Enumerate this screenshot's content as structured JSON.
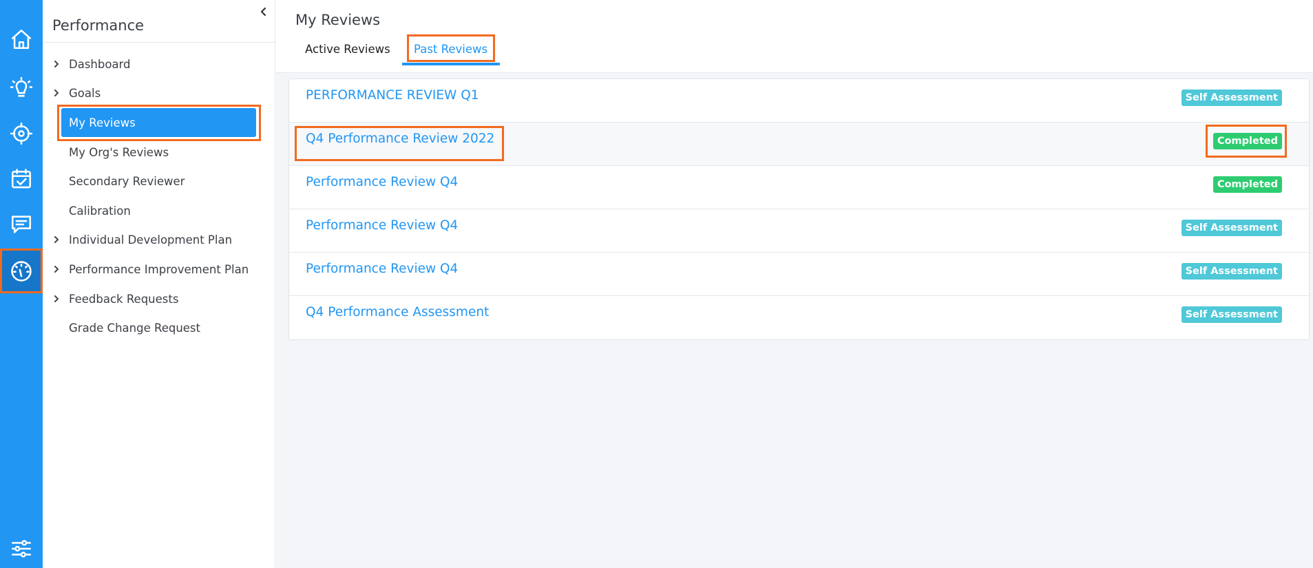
{
  "rail": {
    "items": [
      {
        "icon": "home-icon"
      },
      {
        "icon": "lightbulb-icon"
      },
      {
        "icon": "target-icon"
      },
      {
        "icon": "calendar-check-icon"
      },
      {
        "icon": "chat-icon"
      },
      {
        "icon": "speedometer-icon",
        "active": true
      },
      {
        "icon": "settings-sliders-icon"
      }
    ]
  },
  "sidebar": {
    "title": "Performance",
    "items": [
      {
        "label": "Dashboard",
        "expandable": true
      },
      {
        "label": "Goals",
        "expandable": true
      },
      {
        "label": "My Reviews",
        "active": true
      },
      {
        "label": "My Org's Reviews"
      },
      {
        "label": "Secondary Reviewer"
      },
      {
        "label": "Calibration"
      },
      {
        "label": "Individual Development Plan",
        "expandable": true
      },
      {
        "label": "Performance Improvement Plan",
        "expandable": true
      },
      {
        "label": "Feedback Requests",
        "expandable": true
      },
      {
        "label": "Grade Change Request"
      }
    ]
  },
  "main": {
    "title": "My Reviews",
    "tabs": [
      {
        "label": "Active Reviews"
      },
      {
        "label": "Past Reviews",
        "active": true
      }
    ],
    "reviews": [
      {
        "title": "PERFORMANCE REVIEW Q1",
        "status": "Self Assessment"
      },
      {
        "title": "Q4 Performance Review 2022",
        "status": "Completed"
      },
      {
        "title": "Performance Review Q4",
        "status": "Completed"
      },
      {
        "title": "Performance Review Q4",
        "status": "Self Assessment"
      },
      {
        "title": "Performance Review Q4",
        "status": "Self Assessment"
      },
      {
        "title": "Q4 Performance Assessment",
        "status": "Self Assessment"
      }
    ]
  },
  "colors": {
    "primary": "#2196f3",
    "highlight": "#f36a1f",
    "self_assessment": "#4fc8d8",
    "completed": "#2ecc71"
  }
}
